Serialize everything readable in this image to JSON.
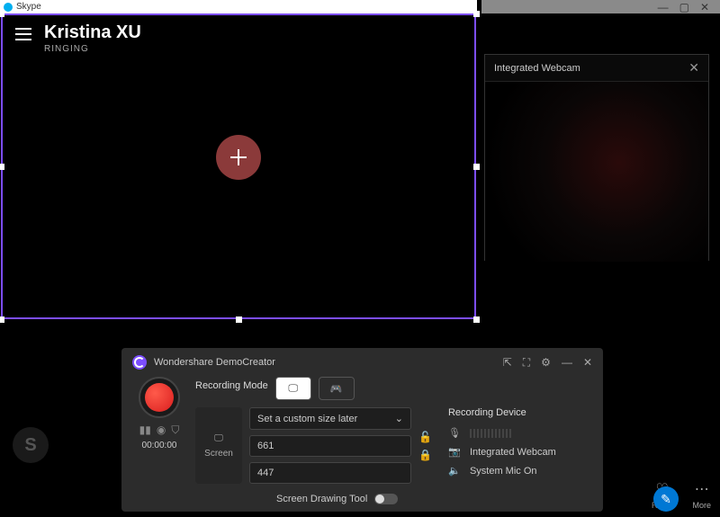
{
  "skype": {
    "title": "Skype",
    "caller_name": "Kristina XU",
    "status": "RINGING"
  },
  "top_chrome": {
    "minimize": "—",
    "maximize": "▢",
    "close": "✕"
  },
  "webcam": {
    "title": "Integrated Webcam",
    "close": "✕"
  },
  "dc": {
    "title": "Wondershare DemoCreator",
    "header_icons": {
      "pip": "⇱",
      "expand": "⛶",
      "settings": "⚙",
      "minimize": "—",
      "close": "✕"
    },
    "timer": "00:00:00",
    "mode_label": "Recording Mode",
    "screen_label": "Screen",
    "size_select": "Set a custom size later",
    "width": "661",
    "height": "447",
    "drawing_label": "Screen Drawing Tool",
    "device_label": "Recording Device",
    "device_cam": "Integrated Webcam",
    "device_mic": "System Mic On",
    "chevron": "⌄"
  },
  "br": {
    "react": "React",
    "more": "More",
    "heart": "♡",
    "dots": "⋯"
  },
  "icons": {
    "monitor": "🖵",
    "gamepad": "🎮",
    "mic": "🎙",
    "cam": "📷",
    "speaker": "🔈",
    "pause": "▮▮",
    "target": "◉",
    "shield": "⛉",
    "lock_open": "🔓",
    "lock": "🔒",
    "pencil": "✎"
  }
}
